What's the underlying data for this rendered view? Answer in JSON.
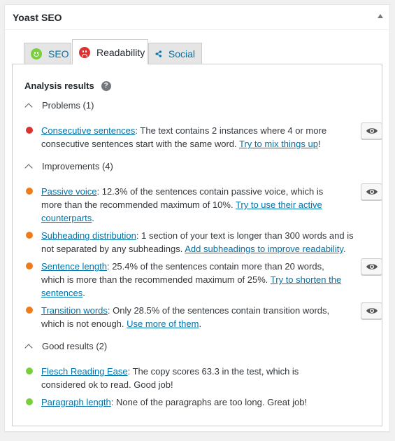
{
  "box": {
    "title": "Yoast SEO"
  },
  "tabs": [
    {
      "label": "SEO",
      "icon": "good-face-icon"
    },
    {
      "label": "Readability",
      "icon": "bad-face-icon"
    },
    {
      "label": "Social",
      "icon": "share-icon"
    }
  ],
  "analysis": {
    "heading": "Analysis results",
    "help": "?",
    "problems": {
      "title": "Problems (1)",
      "items": [
        {
          "link": "Consecutive sentences",
          "text1": ": The text contains 2 instances where 4 or more consecutive sentences start with the same word. ",
          "cta": "Try to mix things up",
          "text2": "!"
        }
      ]
    },
    "improvements": {
      "title": "Improvements (4)",
      "items": [
        {
          "link": "Passive voice",
          "text1": ": 12.3% of the sentences contain passive voice, which is more than the recommended maximum of 10%. ",
          "cta": "Try to use their active counterparts",
          "text2": "."
        },
        {
          "link": "Subheading distribution",
          "text1": ": 1 section of your text is longer than 300 words and is not separated by any subheadings. ",
          "cta": "Add subheadings to improve readability",
          "text2": "."
        },
        {
          "link": "Sentence length",
          "text1": ": 25.4% of the sentences contain more than 20 words, which is more than the recommended maximum of 25%. ",
          "cta": "Try to shorten the sentences",
          "text2": "."
        },
        {
          "link": "Transition words",
          "text1": ": Only 28.5% of the sentences contain transition words, which is not enough. ",
          "cta": "Use more of them",
          "text2": "."
        }
      ]
    },
    "good": {
      "title": "Good results (2)",
      "items": [
        {
          "link": "Flesch Reading Ease",
          "text1": ": The copy scores 63.3 in the test, which is considered ok to read. Good job!"
        },
        {
          "link": "Paragraph length",
          "text1": ": None of the paragraphs are too long. Great job!"
        }
      ]
    }
  },
  "colors": {
    "problem": "#dc3232",
    "improvement": "#ee7c1b",
    "good": "#7ad03a",
    "link": "#0073aa"
  }
}
